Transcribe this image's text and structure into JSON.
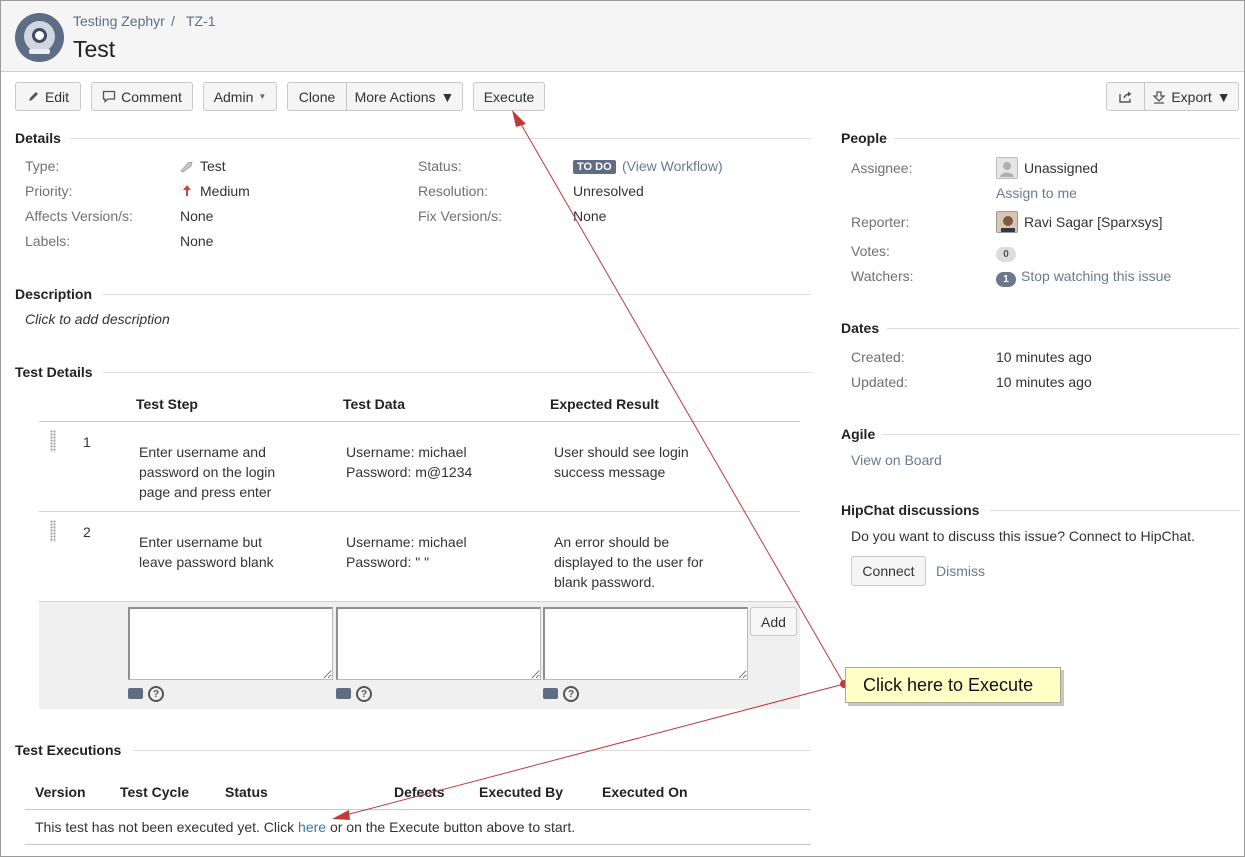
{
  "header": {
    "breadcrumb_project": "Testing Zephyr",
    "breadcrumb_sep": "/",
    "breadcrumb_issue": "TZ-1",
    "title": "Test"
  },
  "toolbar": {
    "edit": "Edit",
    "comment": "Comment",
    "admin": "Admin",
    "clone": "Clone",
    "more_actions": "More Actions",
    "execute": "Execute",
    "export": "Export"
  },
  "details": {
    "title": "Details",
    "type_label": "Type:",
    "type_value": "Test",
    "priority_label": "Priority:",
    "priority_value": "Medium",
    "affects_label": "Affects Version/s:",
    "affects_value": "None",
    "labels_label": "Labels:",
    "labels_value": "None",
    "status_label": "Status:",
    "status_badge": "TO DO",
    "view_workflow": "(View Workflow)",
    "resolution_label": "Resolution:",
    "resolution_value": "Unresolved",
    "fix_label": "Fix Version/s:",
    "fix_value": "None"
  },
  "description": {
    "title": "Description",
    "placeholder": "Click to add description"
  },
  "test_details": {
    "title": "Test Details",
    "columns": [
      "Test Step",
      "Test Data",
      "Expected Result"
    ],
    "steps": [
      {
        "num": "1",
        "step": "Enter username and password on the login page and press enter",
        "data": "Username: michael Password: m@1234",
        "expected": "User should see login success message"
      },
      {
        "num": "2",
        "step": "Enter username but leave password blank",
        "data": "Username: michael Password: \" \"",
        "expected": "An error should be displayed to the user for blank password."
      }
    ],
    "add_button": "Add"
  },
  "test_executions": {
    "title": "Test Executions",
    "columns": [
      "Version",
      "Test Cycle",
      "Status",
      "Defects",
      "Executed By",
      "Executed On"
    ],
    "empty_before": "This test has not been executed yet. Click",
    "empty_link": "here",
    "empty_after": "or on the Execute button above to start."
  },
  "people": {
    "title": "People",
    "assignee_label": "Assignee:",
    "assignee_value": "Unassigned",
    "assign_to_me": "Assign to me",
    "reporter_label": "Reporter:",
    "reporter_value": "Ravi Sagar [Sparxsys]",
    "votes_label": "Votes:",
    "votes_count": "0",
    "watchers_label": "Watchers:",
    "watchers_count": "1",
    "stop_watching": "Stop watching this issue"
  },
  "dates": {
    "title": "Dates",
    "created_label": "Created:",
    "created_value": "10 minutes ago",
    "updated_label": "Updated:",
    "updated_value": "10 minutes ago"
  },
  "agile": {
    "title": "Agile",
    "view_on_board": "View on Board"
  },
  "hipchat": {
    "title": "HipChat discussions",
    "prompt": "Do you want to discuss this issue? Connect to HipChat.",
    "connect": "Connect",
    "dismiss": "Dismiss"
  },
  "annotation": {
    "callout": "Click here to Execute",
    "arrow_color": "#c0393b"
  },
  "colors": {
    "link": "#3b73af",
    "status_badge": "#5e6c84",
    "priority_arrow": "#d04437"
  }
}
